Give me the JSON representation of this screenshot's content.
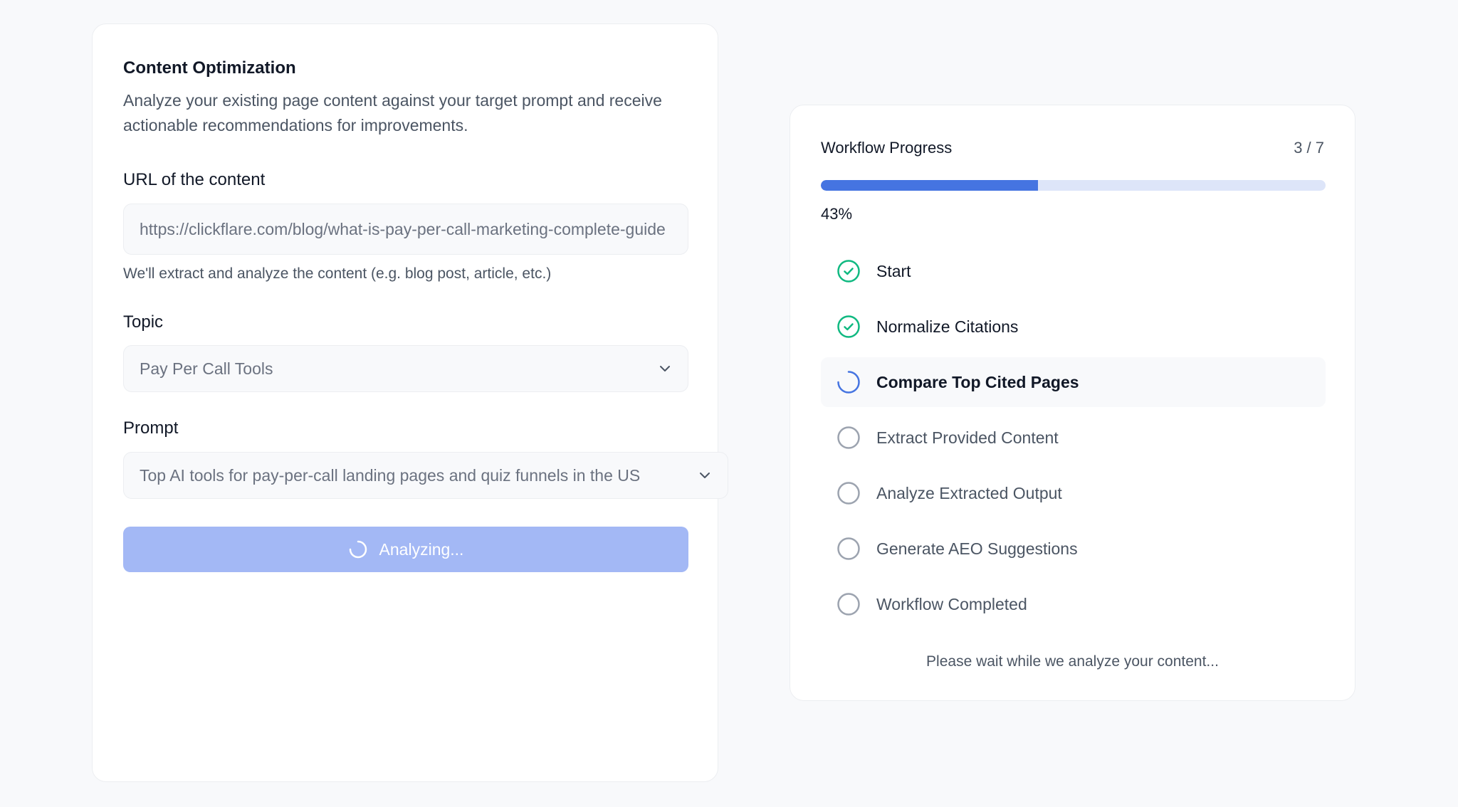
{
  "form": {
    "title": "Content Optimization",
    "description": "Analyze your existing page content against your target prompt and receive actionable recommendations for improvements.",
    "url_label": "URL of the content",
    "url_value": "https://clickflare.com/blog/what-is-pay-per-call-marketing-complete-guide",
    "url_hint": "We'll extract and analyze the content (e.g. blog post, article, etc.)",
    "topic_label": "Topic",
    "topic_value": "Pay Per Call Tools",
    "prompt_label": "Prompt",
    "prompt_value": "Top AI tools for pay-per-call landing pages and quiz funnels in the US",
    "button_label": "Analyzing..."
  },
  "progress": {
    "title": "Workflow Progress",
    "count": "3 / 7",
    "percent_text": "43%",
    "fraction": 0.43,
    "steps": [
      {
        "label": "Start",
        "status": "done"
      },
      {
        "label": "Normalize Citations",
        "status": "done"
      },
      {
        "label": "Compare Top Cited Pages",
        "status": "active"
      },
      {
        "label": "Extract Provided Content",
        "status": "pending"
      },
      {
        "label": "Analyze Extracted Output",
        "status": "pending"
      },
      {
        "label": "Generate AEO Suggestions",
        "status": "pending"
      },
      {
        "label": "Workflow Completed",
        "status": "pending"
      }
    ],
    "wait_text": "Please wait while we analyze your content..."
  },
  "colors": {
    "accent": "#4574e1",
    "success": "#10b981",
    "button_disabled": "#a3b8f5"
  }
}
